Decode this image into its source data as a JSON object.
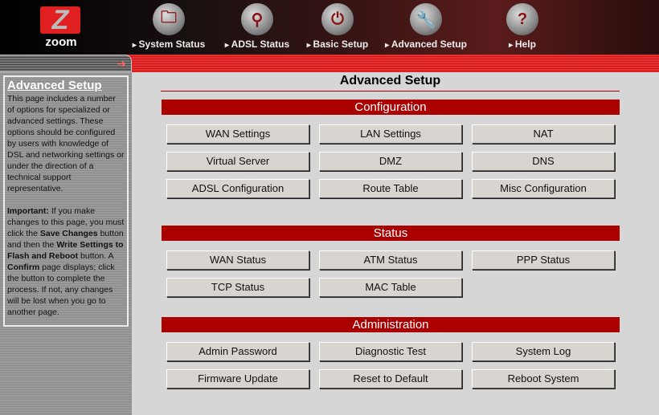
{
  "header": {
    "logo": "zoom",
    "nav": [
      {
        "label": "System Status",
        "icon": "folder-icon"
      },
      {
        "label": "ADSL Status",
        "icon": "magnifier-icon"
      },
      {
        "label": "Basic Setup",
        "icon": "plug-icon"
      },
      {
        "label": "Advanced Setup",
        "icon": "wrench-icon"
      },
      {
        "label": "Help",
        "icon": "question-icon"
      }
    ]
  },
  "sidebar": {
    "title": "Advanced Setup",
    "p1": "This page includes a number of options for specialized or advanced settings. These options should be configured by users with knowledge of DSL and networking settings or under the direction of a technical support representative.",
    "p2": [
      {
        "t": "Important:",
        "b": true
      },
      {
        "t": " If you make changes to this page, you must click the "
      },
      {
        "t": "Save Changes",
        "b": true
      },
      {
        "t": " button and then the "
      },
      {
        "t": "Write Settings to Flash and Reboot",
        "b": true
      },
      {
        "t": " button. A "
      },
      {
        "t": "Confirm",
        "b": true
      },
      {
        "t": " page displays; click the button to complete the process. If not, any changes will be lost when you go to another page."
      }
    ]
  },
  "main": {
    "title": "Advanced Setup",
    "sections": [
      {
        "title": "Configuration",
        "buttons": [
          "WAN Settings",
          "LAN Settings",
          "NAT",
          "Virtual Server",
          "DMZ",
          "DNS",
          "ADSL Configuration",
          "Route Table",
          "Misc Configuration"
        ]
      },
      {
        "title": "Status",
        "buttons": [
          "WAN Status",
          "ATM Status",
          "PPP Status",
          "TCP Status",
          "MAC Table"
        ]
      },
      {
        "title": "Administration",
        "buttons": [
          "Admin Password",
          "Diagnostic Test",
          "System Log",
          "Firmware Update",
          "Reset to Default",
          "Reboot System"
        ]
      }
    ]
  }
}
